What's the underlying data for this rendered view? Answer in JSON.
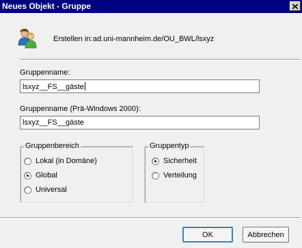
{
  "window": {
    "title": "Neues Objekt - Gruppe"
  },
  "header": {
    "create_in_label": "Erstellen in:",
    "create_in_path": "ad.uni-mannheim.de/OU_BWL/lsxyz"
  },
  "form": {
    "group_name_label": "Gruppenname:",
    "group_name_value": "lsxyz__FS__gäste",
    "pre2000_label": "Gruppenname (Prä-Windows 2000):",
    "pre2000_value": "lsxyz__FS__gäste"
  },
  "scope": {
    "title": "Gruppenbereich",
    "options": [
      {
        "label": "Lokal (in Domäne)",
        "checked": false
      },
      {
        "label": "Global",
        "checked": true
      },
      {
        "label": "Universal",
        "checked": false
      }
    ]
  },
  "type": {
    "title": "Gruppentyp",
    "options": [
      {
        "label": "Sicherheit",
        "checked": true
      },
      {
        "label": "Verteilung",
        "checked": false
      }
    ]
  },
  "buttons": {
    "ok": "OK",
    "cancel": "Abbrechen"
  },
  "icons": {
    "title_close": "close-icon",
    "group": "users-icon"
  }
}
